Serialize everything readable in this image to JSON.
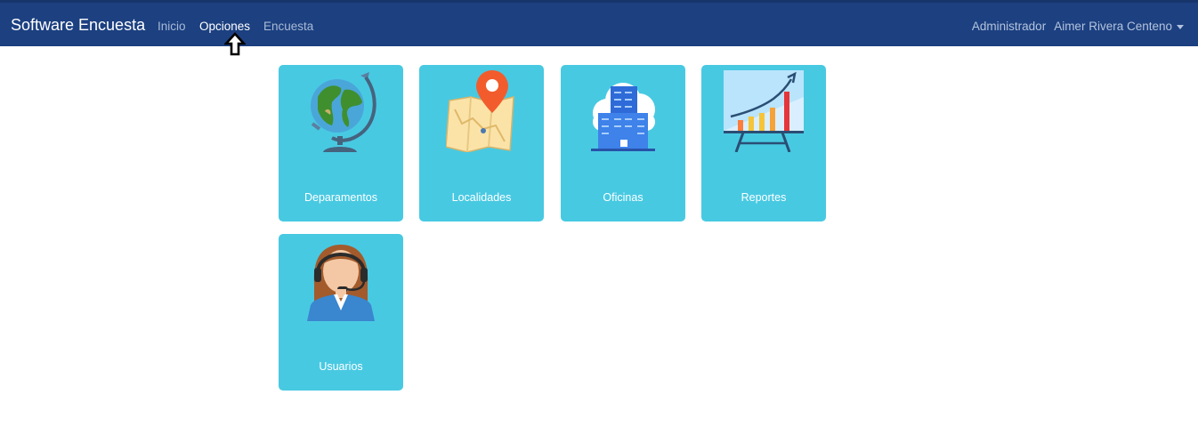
{
  "navbar": {
    "brand": "Software Encuesta",
    "links": [
      {
        "label": "Inicio",
        "active": false
      },
      {
        "label": "Opciones",
        "active": true
      },
      {
        "label": "Encuesta",
        "active": false
      }
    ],
    "role": "Administrador",
    "user_name": "Aimer Rivera Centeno",
    "background_color": "#1c4080"
  },
  "tiles": [
    {
      "label": "Deparamentos",
      "icon": "globe-icon"
    },
    {
      "label": "Localidades",
      "icon": "map-pin-icon"
    },
    {
      "label": "Oficinas",
      "icon": "cloud-building-icon"
    },
    {
      "label": "Reportes",
      "icon": "chart-board-icon"
    },
    {
      "label": "Usuarios",
      "icon": "operator-headset-icon"
    }
  ],
  "tile_color": "#48c9e2",
  "cursor_icon": "up-arrow-pointer-icon"
}
